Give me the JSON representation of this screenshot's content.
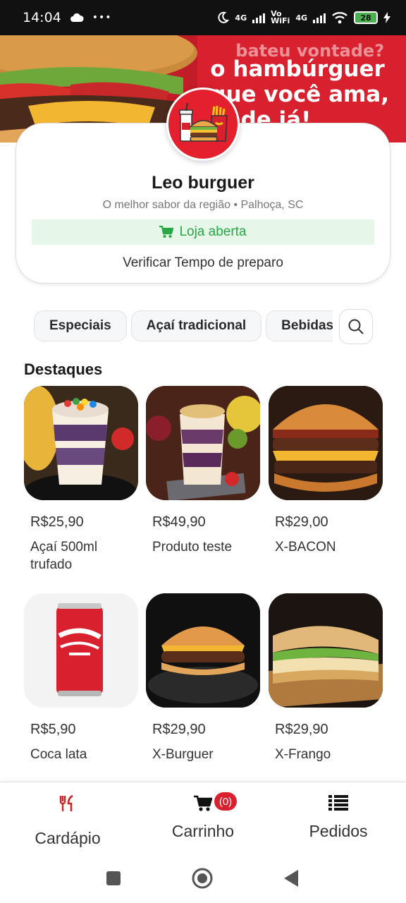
{
  "status_bar": {
    "time": "14:04",
    "more": "•••",
    "net1": "4G",
    "vowifi_top": "Vo",
    "vowifi_bottom": "WiFi",
    "net2": "4G",
    "battery": "28"
  },
  "banner": {
    "line0": "bateu vontade?",
    "line1": "o hambúrguer",
    "line2": "que você ama,",
    "line3": "pede já!"
  },
  "store": {
    "name": "Leo burguer",
    "subtitle": "O melhor sabor da região • Palhoça, SC",
    "status": "Loja aberta",
    "prep_time_link": "Verificar Tempo de preparo"
  },
  "categories": [
    "Especiais",
    "Açaí tradicional",
    "Bebidas"
  ],
  "section_title": "Destaques",
  "products": [
    {
      "price": "R$25,90",
      "name": "Açaí 500ml trufado"
    },
    {
      "price": "R$49,90",
      "name": "Produto teste"
    },
    {
      "price": "R$29,00",
      "name": "X-BACON"
    },
    {
      "price": "R$5,90",
      "name": "Coca lata"
    },
    {
      "price": "R$29,90",
      "name": "X-Burguer"
    },
    {
      "price": "R$29,90",
      "name": "X-Frango"
    }
  ],
  "bottom_nav": {
    "menu_label": "Cardápio",
    "cart_label": "Carrinho",
    "cart_count": "(0)",
    "orders_label": "Pedidos"
  },
  "colors": {
    "brand_red": "#d8202e",
    "open_green": "#27a844",
    "open_bg": "#e6f6e9"
  }
}
